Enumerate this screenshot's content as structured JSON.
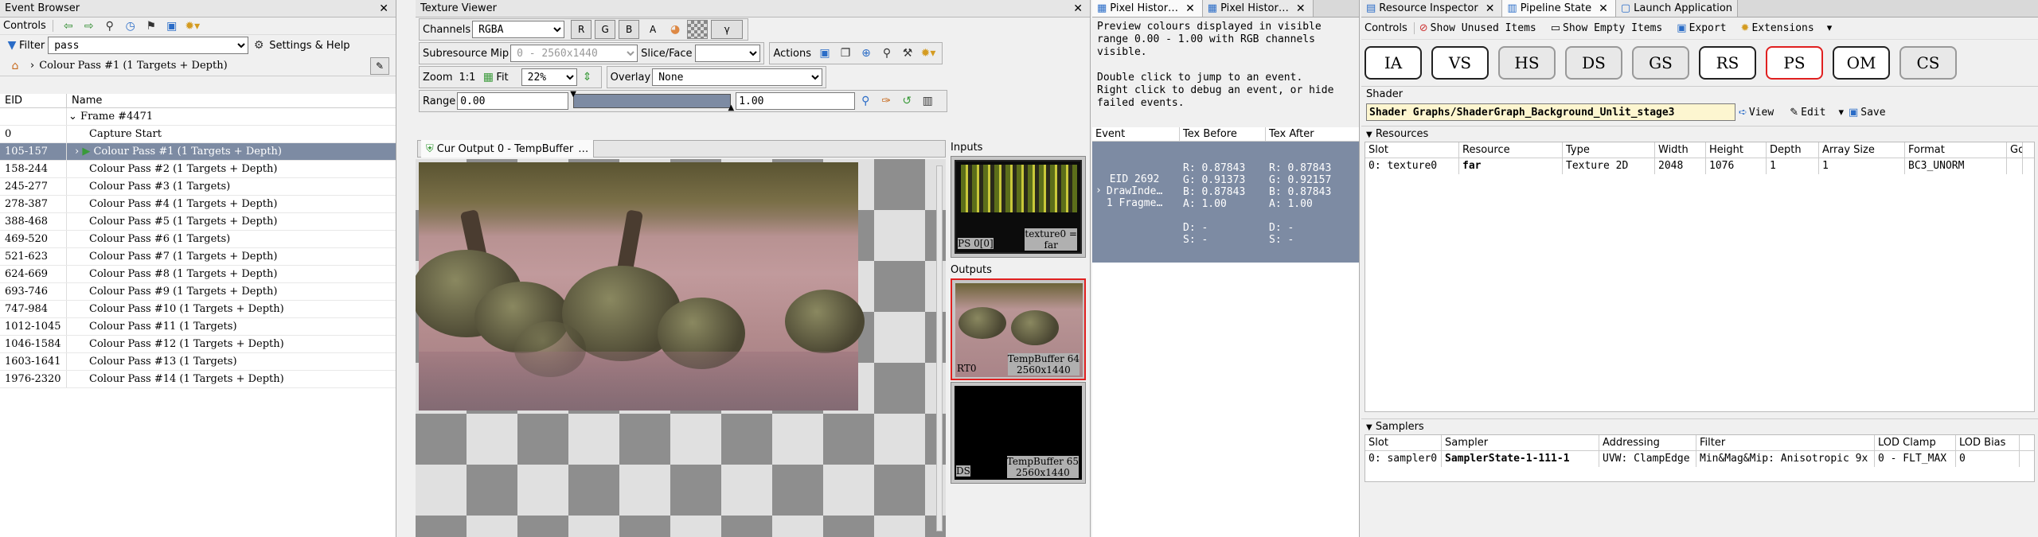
{
  "event_browser": {
    "title": "Event Browser",
    "controls_label": "Controls",
    "filter_label": "Filter",
    "filter_value": "pass",
    "settings_label": "Settings & Help",
    "breadcrumb": "Colour Pass #1 (1 Targets + Depth)",
    "columns": {
      "eid": "EID",
      "name": "Name"
    },
    "frame_label": "Frame #4471",
    "rows": [
      {
        "eid": "0",
        "name": "Capture Start"
      },
      {
        "eid": "105-157",
        "name": "Colour Pass #1 (1 Targets + Depth)"
      },
      {
        "eid": "158-244",
        "name": "Colour Pass #2 (1 Targets + Depth)"
      },
      {
        "eid": "245-277",
        "name": "Colour Pass #3 (1 Targets)"
      },
      {
        "eid": "278-387",
        "name": "Colour Pass #4 (1 Targets + Depth)"
      },
      {
        "eid": "388-468",
        "name": "Colour Pass #5 (1 Targets + Depth)"
      },
      {
        "eid": "469-520",
        "name": "Colour Pass #6 (1 Targets)"
      },
      {
        "eid": "521-623",
        "name": "Colour Pass #7 (1 Targets + Depth)"
      },
      {
        "eid": "624-669",
        "name": "Colour Pass #8 (1 Targets + Depth)"
      },
      {
        "eid": "693-746",
        "name": "Colour Pass #9 (1 Targets + Depth)"
      },
      {
        "eid": "747-984",
        "name": "Colour Pass #10 (1 Targets + Depth)"
      },
      {
        "eid": "1012-1045",
        "name": "Colour Pass #11 (1 Targets)"
      },
      {
        "eid": "1046-1584",
        "name": "Colour Pass #12 (1 Targets + Depth)"
      },
      {
        "eid": "1603-1641",
        "name": "Colour Pass #13 (1 Targets)"
      },
      {
        "eid": "1976-2320",
        "name": "Colour Pass #14 (1 Targets + Depth)"
      }
    ]
  },
  "texture_viewer": {
    "title": "Texture Viewer",
    "channels_label": "Channels",
    "channels_value": "RGBA",
    "ch_r": "R",
    "ch_g": "G",
    "ch_b": "B",
    "ch_a": "A",
    "ch_gamma": "γ",
    "subresource_label": "Subresource",
    "mip_label": "Mip",
    "mip_value": "0 - 2560x1440",
    "slice_label": "Slice/Face",
    "actions_label": "Actions",
    "zoom_label": "Zoom",
    "zoom_one": "1:1",
    "fit_label": "Fit",
    "zoom_value": "22%",
    "overlay_label": "Overlay",
    "overlay_value": "None",
    "range_label": "Range",
    "range_min": "0.00",
    "range_max": "1.00",
    "tab_label": "Cur Output 0 - TempBuffer",
    "inputs_label": "Inputs",
    "input_thumb": {
      "slot": "PS 0[0]",
      "caption": "texture0 =\nfar"
    },
    "outputs_label": "Outputs",
    "output_thumbs": [
      {
        "slot": "RT0",
        "caption": "TempBuffer 64\n2560x1440"
      },
      {
        "slot": "DS",
        "caption": "TempBuffer 65\n2560x1440"
      }
    ]
  },
  "pixel_history": {
    "tab1": "Pixel Histor…",
    "tab2": "Pixel Histor…",
    "description": "Preview colours displayed in visible range 0.00 - 1.00 with RGB channels visible.\n\nDouble click to jump to an event.\nRight click to debug an event, or hide failed events.",
    "columns": {
      "event": "Event",
      "before": "Tex Before",
      "after": "Tex After"
    },
    "row": {
      "event": "EID 2692\nDrawInde…\n1 Fragme…",
      "before": "R: 0.87843\nG: 0.91373\nB: 0.87843\nA: 1.00\n\nD: -\nS: -",
      "after": "R: 0.87843\nG: 0.92157\nB: 0.87843\nA: 1.00\n\nD: -\nS: -"
    }
  },
  "pipeline": {
    "tabs": [
      "Resource Inspector",
      "Pipeline State",
      "Launch Application"
    ],
    "controls_label": "Controls",
    "show_unused": "Show Unused Items",
    "show_empty": "Show Empty Items",
    "export": "Export",
    "extensions": "Extensions",
    "stages": [
      "IA",
      "VS",
      "HS",
      "DS",
      "GS",
      "RS",
      "PS",
      "OM",
      "CS"
    ],
    "shader_label": "Shader",
    "shader_value": "Shader Graphs/ShaderGraph_Background_Unlit_stage3",
    "view_label": "View",
    "edit_label": "Edit",
    "save_label": "Save",
    "resources_label": "Resources",
    "res_columns": [
      "Slot",
      "Resource",
      "Type",
      "Width",
      "Height",
      "Depth",
      "Array Size",
      "Format",
      "Go"
    ],
    "res_row": [
      "0: texture0",
      "far",
      "Texture 2D",
      "2048",
      "1076",
      "1",
      "1",
      "BC3_UNORM",
      ""
    ],
    "samplers_label": "Samplers",
    "samp_columns": [
      "Slot",
      "Sampler",
      "Addressing",
      "Filter",
      "LOD Clamp",
      "LOD Bias"
    ],
    "samp_row": [
      "0: sampler0",
      "SamplerState-1-111-1",
      "UVW: ClampEdge",
      "Min&Mag&Mip: Anisotropic 9x",
      "0 - FLT_MAX",
      "0"
    ]
  }
}
